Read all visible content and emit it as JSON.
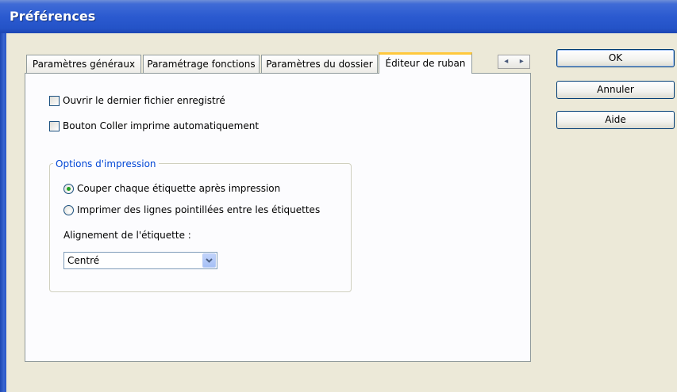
{
  "window": {
    "title": "Préférences"
  },
  "tabs": [
    {
      "label": "Paramètres généraux",
      "active": false
    },
    {
      "label": "Paramétrage fonctions",
      "active": false
    },
    {
      "label": "Paramètres du dossier",
      "active": false
    },
    {
      "label": "Éditeur de ruban",
      "active": true
    }
  ],
  "tab_scroll": {
    "left": "◂",
    "right": "▸"
  },
  "options": {
    "open_last_file": {
      "label": "Ouvrir le dernier fichier enregistré",
      "checked": false
    },
    "paste_button_autoprint": {
      "label": "Bouton Coller imprime automatiquement",
      "checked": false
    }
  },
  "print_options": {
    "title": "Options d'impression",
    "cut_each_label": {
      "label": "Couper chaque étiquette après impression",
      "checked": true
    },
    "dotted_lines": {
      "label": "Imprimer des lignes pointillées entre les étiquettes",
      "checked": false
    },
    "alignment_label": "Alignement de l'étiquette :",
    "alignment_value": "Centré"
  },
  "buttons": {
    "ok": "OK",
    "cancel": "Annuler",
    "help": "Aide"
  },
  "colors": {
    "title_bar": "#2b5ad0",
    "group_title": "#0046d5",
    "active_tab_accent": "#ffc83c",
    "radio_checked": "#21a121"
  }
}
